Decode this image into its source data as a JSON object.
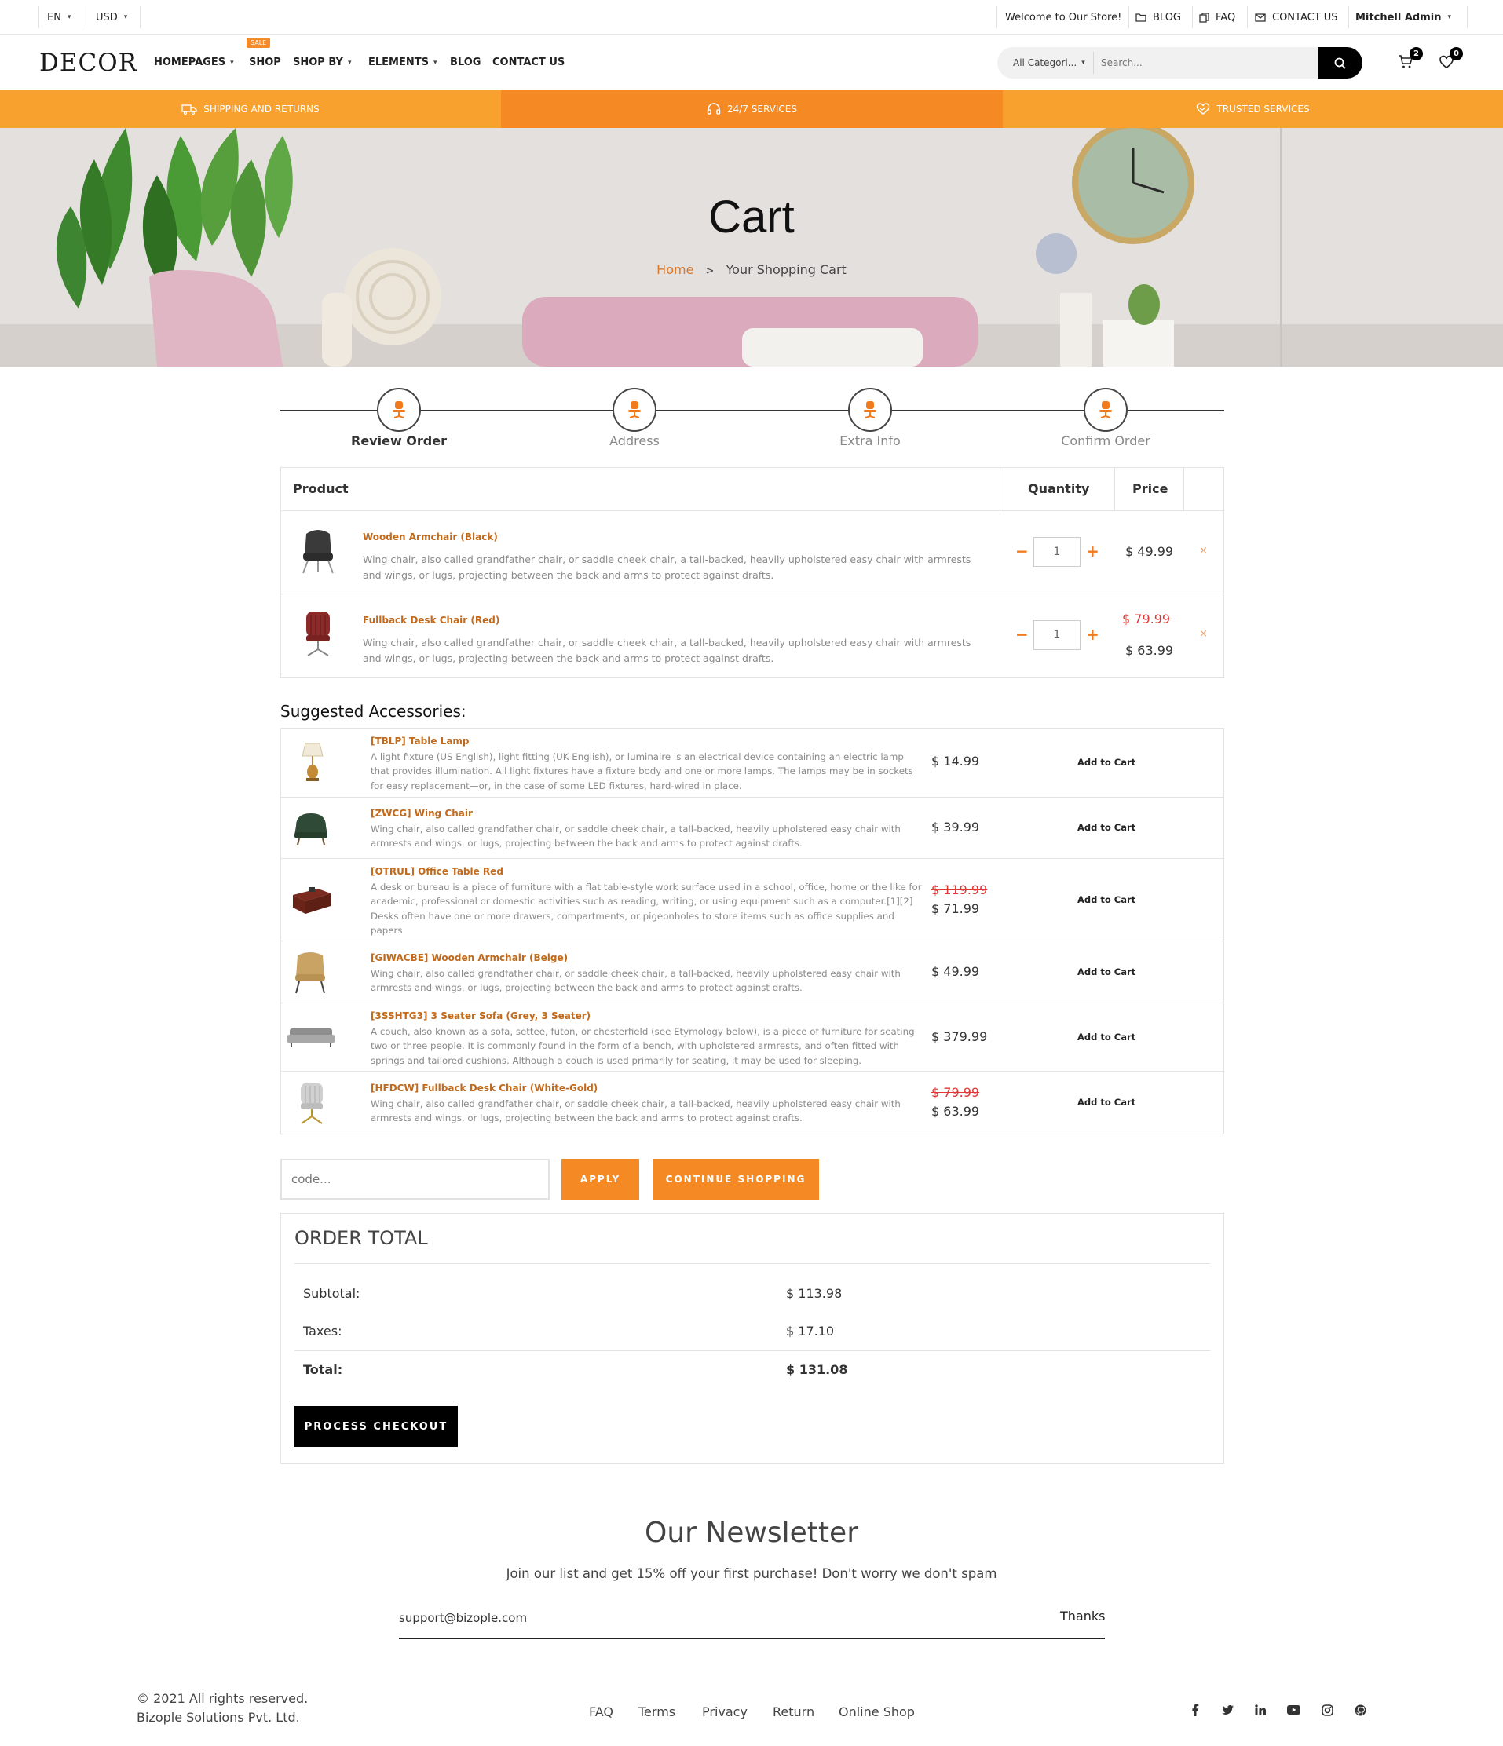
{
  "topbar": {
    "language": "EN",
    "currency": "USD",
    "welcome": "Welcome to Our Store!",
    "blog": "BLOG",
    "faq": "FAQ",
    "contact": "CONTACT US",
    "user": "Mitchell Admin"
  },
  "nav": {
    "logo": "DECOR",
    "menu": [
      "HOMEPAGES",
      "SHOP",
      "SHOP BY",
      "ELEMENTS",
      "BLOG",
      "CONTACT US"
    ],
    "sale_tag": "SALE",
    "search_category": "All Categori...",
    "search_placeholder": "Search...",
    "cart_count": "2",
    "wishlist_count": "0"
  },
  "services": {
    "shipping": "SHIPPING AND RETURNS",
    "support": "24/7 SERVICES",
    "trusted": "TRUSTED SERVICES"
  },
  "hero": {
    "title": "Cart",
    "breadcrumb_home": "Home",
    "breadcrumb_current": "Your Shopping Cart"
  },
  "steps": [
    "Review Order",
    "Address",
    "Extra Info",
    "Confirm Order"
  ],
  "cart": {
    "headers": {
      "product": "Product",
      "quantity": "Quantity",
      "price": "Price"
    },
    "items": [
      {
        "name": "Wooden Armchair (Black)",
        "desc": "Wing chair, also called grandfather chair, or saddle cheek chair, a tall-backed, heavily upholstered easy chair with armrests and wings, or lugs, projecting between the back and arms to protect against drafts.",
        "qty": "1",
        "price": "$ 49.99",
        "old_price": ""
      },
      {
        "name": "Fullback Desk Chair (Red)",
        "desc": "Wing chair, also called grandfather chair, or saddle cheek chair, a tall-backed, heavily upholstered easy chair with armrests and wings, or lugs, projecting between the back and arms to protect against drafts.",
        "qty": "1",
        "price": "$ 63.99",
        "old_price": "$ 79.99"
      }
    ]
  },
  "suggested": {
    "heading": "Suggested Accessories:",
    "add_label": "Add to Cart",
    "items": [
      {
        "name": "[TBLP] Table Lamp",
        "desc": "A light fixture (US English), light fitting (UK English), or luminaire is an electrical device containing an electric lamp that provides illumination. All light fixtures have a fixture body and one or more lamps. The lamps may be in sockets for easy replacement—or, in the case of some LED fixtures, hard-wired in place.",
        "price": "$ 14.99",
        "old_price": ""
      },
      {
        "name": "[ZWCG] Wing Chair",
        "desc": "Wing chair, also called grandfather chair, or saddle cheek chair, a tall-backed, heavily upholstered easy chair with armrests and wings, or lugs, projecting between the back and arms to protect against drafts.",
        "price": "$ 39.99",
        "old_price": ""
      },
      {
        "name": "[OTRUL] Office Table Red",
        "desc": "A desk or bureau is a piece of furniture with a flat table-style work surface used in a school, office, home or the like for academic, professional or domestic activities such as reading, writing, or using equipment such as a computer.[1][2] Desks often have one or more drawers, compartments, or pigeonholes to store items such as office supplies and papers",
        "price": "$ 71.99",
        "old_price": "$ 119.99"
      },
      {
        "name": "[GIWACBE] Wooden Armchair (Beige)",
        "desc": "Wing chair, also called grandfather chair, or saddle cheek chair, a tall-backed, heavily upholstered easy chair with armrests and wings, or lugs, projecting between the back and arms to protect against drafts.",
        "price": "$ 49.99",
        "old_price": ""
      },
      {
        "name": "[3SSHTG3] 3 Seater Sofa (Grey, 3 Seater)",
        "desc": "A couch, also known as a sofa, settee, futon, or chesterfield (see Etymology below), is a piece of furniture for seating two or three people. It is commonly found in the form of a bench, with upholstered armrests, and often fitted with springs and tailored cushions. Although a couch is used primarily for seating, it may be used for sleeping.",
        "price": "$ 379.99",
        "old_price": ""
      },
      {
        "name": "[HFDCW] Fullback Desk Chair (White-Gold)",
        "desc": "Wing chair, also called grandfather chair, or saddle cheek chair, a tall-backed, heavily upholstered easy chair with armrests and wings, or lugs, projecting between the back and arms to protect against drafts.",
        "price": "$ 63.99",
        "old_price": "$ 79.99"
      }
    ]
  },
  "coupon": {
    "placeholder": "code...",
    "apply": "APPLY",
    "continue": "CONTINUE SHOPPING"
  },
  "order_total": {
    "heading": "ORDER TOTAL",
    "subtotal_label": "Subtotal:",
    "subtotal": "$ 113.98",
    "taxes_label": "Taxes:",
    "taxes": "$ 17.10",
    "total_label": "Total:",
    "total": "$ 131.08",
    "checkout": "PROCESS CHECKOUT"
  },
  "newsletter": {
    "title": "Our Newsletter",
    "subtitle": "Join our list and get 15% off your first purchase! Don't worry we don't spam",
    "email_value": "support@bizople.com",
    "button": "Thanks"
  },
  "footer": {
    "copyright": "© 2021 All rights reserved.",
    "company": "Bizople Solutions Pvt. Ltd.",
    "links": [
      "FAQ",
      "Terms",
      "Privacy",
      "Return",
      "Online Shop"
    ],
    "social": [
      "facebook-icon",
      "twitter-icon",
      "linkedin-icon",
      "youtube-icon",
      "instagram-icon",
      "github-icon"
    ]
  },
  "colors": {
    "accent": "#f58a25",
    "accent_dark": "#f07a1c",
    "product_link": "#c26a1c",
    "strike": "#e03838"
  }
}
